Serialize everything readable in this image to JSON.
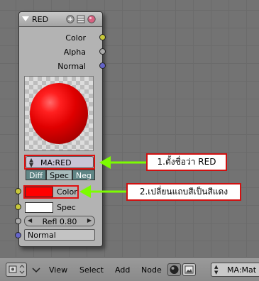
{
  "node": {
    "title": "RED",
    "outputs": [
      {
        "label": "Color",
        "color": "#c8c83a"
      },
      {
        "label": "Alpha",
        "color": "#a8a8a8"
      },
      {
        "label": "Normal",
        "color": "#6464c8"
      }
    ],
    "material_field": "MA:RED",
    "tabs": [
      "Diff",
      "Spec",
      "Neg"
    ],
    "active_tab": "Spec",
    "inputs": {
      "color_label": "Color",
      "color_swatch": "#ff0000",
      "spec_label": "Spec",
      "spec_swatch": "#ffffff",
      "refl": "Refl 0.80",
      "normal": "Normal"
    }
  },
  "annotations": {
    "callout1": "1.ตั้งชื่อว่า  RED",
    "callout2": "2.เปลี่ยนแถบสีเป็นสีแดง",
    "arrow_color": "#7cfc00",
    "box_color": "#e01010"
  },
  "header": {
    "menu": [
      "View",
      "Select",
      "Add",
      "Node"
    ],
    "material_field": "MA:Mat"
  }
}
